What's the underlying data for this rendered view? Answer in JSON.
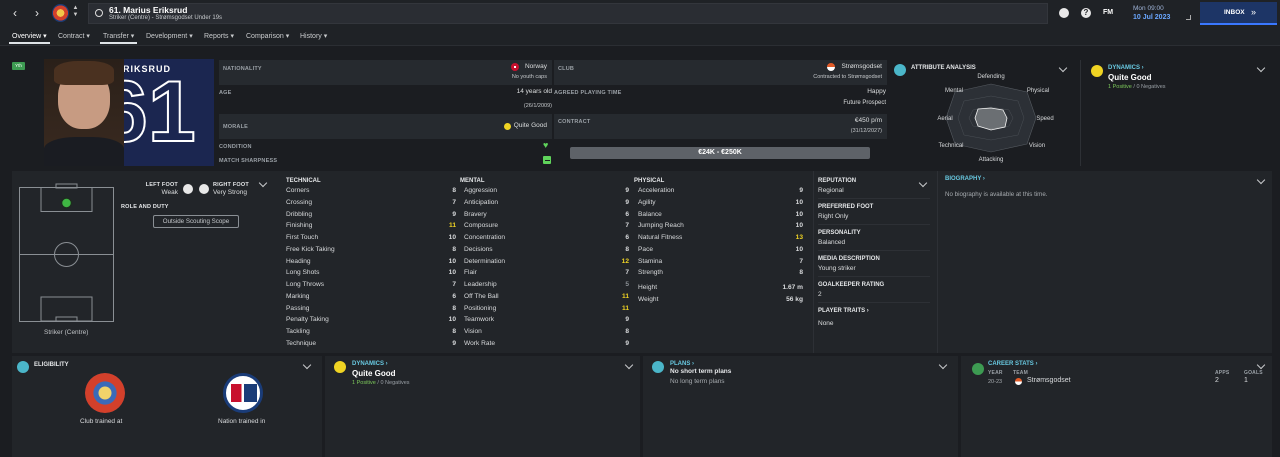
{
  "header": {
    "player_title": "61. Marius Eriksrud",
    "subtitle": "Striker (Centre) - Strømsgodset Under 19s",
    "fm": "FM",
    "time": "Mon 09:00",
    "date": "10 Jul 2023",
    "inbox": "INBOX"
  },
  "tabs": [
    {
      "label": "Overview"
    },
    {
      "label": "Contract"
    },
    {
      "label": "Transfer"
    },
    {
      "label": "Development"
    },
    {
      "label": "Reports"
    },
    {
      "label": "Comparison"
    },
    {
      "label": "History"
    }
  ],
  "profile": {
    "badge": "Yth",
    "shirt_name": "ERIKSRUD",
    "shirt_number": "61"
  },
  "info": {
    "nationality_label": "NATIONALITY",
    "nationality": "Norway",
    "youth_caps": "No youth caps",
    "club_label": "CLUB",
    "club": "Strømsgodset",
    "club_contract": "Contracted to Strømsgodset",
    "age_label": "AGE",
    "age": "14 years old",
    "dob": "(26/1/2009)",
    "playing_time_label": "AGREED PLAYING TIME",
    "playing_time": "Happy",
    "prospect": "Future Prospect",
    "morale_label": "MORALE",
    "morale": "Quite Good",
    "contract_label": "CONTRACT",
    "wage": "€450 p/m",
    "expiry": "(31/12/2027)",
    "condition_label": "CONDITION",
    "sharpness_label": "MATCH SHARPNESS",
    "value_range": "€24K - €250K"
  },
  "attribute_analysis": {
    "title": "ATTRIBUTE ANALYSIS",
    "axes": [
      "Defending",
      "Physical",
      "Speed",
      "Vision",
      "Attacking",
      "Technical",
      "Aerial",
      "Mental"
    ]
  },
  "dynamics": {
    "title": "DYNAMICS",
    "value": "Quite Good",
    "positive": "1 Positive",
    "negative": "0 Negatives",
    "sep": "/"
  },
  "pitch": {
    "left_foot_label": "LEFT FOOT",
    "left_foot": "Weak",
    "right_foot_label": "RIGHT FOOT",
    "right_foot": "Very Strong",
    "role_label": "ROLE AND DUTY",
    "scope_btn": "Outside Scouting Scope",
    "position": "Striker (Centre)"
  },
  "technical": {
    "title": "TECHNICAL",
    "rows": [
      [
        "Corners",
        "8"
      ],
      [
        "Crossing",
        "7"
      ],
      [
        "Dribbling",
        "9"
      ],
      [
        "Finishing",
        "11"
      ],
      [
        "First Touch",
        "10"
      ],
      [
        "Free Kick Taking",
        "8"
      ],
      [
        "Heading",
        "10"
      ],
      [
        "Long Shots",
        "10"
      ],
      [
        "Long Throws",
        "7"
      ],
      [
        "Marking",
        "6"
      ],
      [
        "Passing",
        "8"
      ],
      [
        "Penalty Taking",
        "10"
      ],
      [
        "Tackling",
        "8"
      ],
      [
        "Technique",
        "9"
      ]
    ]
  },
  "mental": {
    "title": "MENTAL",
    "rows": [
      [
        "Aggression",
        "9"
      ],
      [
        "Anticipation",
        "9"
      ],
      [
        "Bravery",
        "6"
      ],
      [
        "Composure",
        "7"
      ],
      [
        "Concentration",
        "6"
      ],
      [
        "Decisions",
        "8"
      ],
      [
        "Determination",
        "12"
      ],
      [
        "Flair",
        "7"
      ],
      [
        "Leadership",
        "5"
      ],
      [
        "Off The Ball",
        "11"
      ],
      [
        "Positioning",
        "11"
      ],
      [
        "Teamwork",
        "9"
      ],
      [
        "Vision",
        "8"
      ],
      [
        "Work Rate",
        "9"
      ]
    ]
  },
  "physical": {
    "title": "PHYSICAL",
    "rows": [
      [
        "Acceleration",
        "9"
      ],
      [
        "Agility",
        "10"
      ],
      [
        "Balance",
        "10"
      ],
      [
        "Jumping Reach",
        "10"
      ],
      [
        "Natural Fitness",
        "13"
      ],
      [
        "Pace",
        "10"
      ],
      [
        "Stamina",
        "7"
      ],
      [
        "Strength",
        "8"
      ]
    ],
    "height_label": "Height",
    "height": "1.67 m",
    "weight_label": "Weight",
    "weight": "56 kg"
  },
  "traits": {
    "reputation_label": "REPUTATION",
    "reputation": "Regional",
    "foot_label": "PREFERRED FOOT",
    "foot": "Right Only",
    "personality_label": "PERSONALITY",
    "personality": "Balanced",
    "media_label": "MEDIA DESCRIPTION",
    "media": "Young striker",
    "gk_label": "GOALKEEPER RATING",
    "gk": "2",
    "traits_label": "PLAYER TRAITS",
    "traits": "None"
  },
  "biography": {
    "title": "BIOGRAPHY",
    "text": "No biography is available at this time."
  },
  "eligibility": {
    "title": "ELIGIBILITY",
    "club_trained": "Club trained at",
    "nation_trained": "Nation trained in"
  },
  "plans": {
    "title": "PLANS",
    "short": "No short term plans",
    "long": "No long term plans"
  },
  "career": {
    "title": "CAREER STATS",
    "year_h": "YEAR",
    "team_h": "TEAM",
    "apps_h": "APPS",
    "goals_h": "GOALS",
    "year": "20-23",
    "team": "Strømsgodset",
    "apps": "2",
    "goals": "1"
  }
}
